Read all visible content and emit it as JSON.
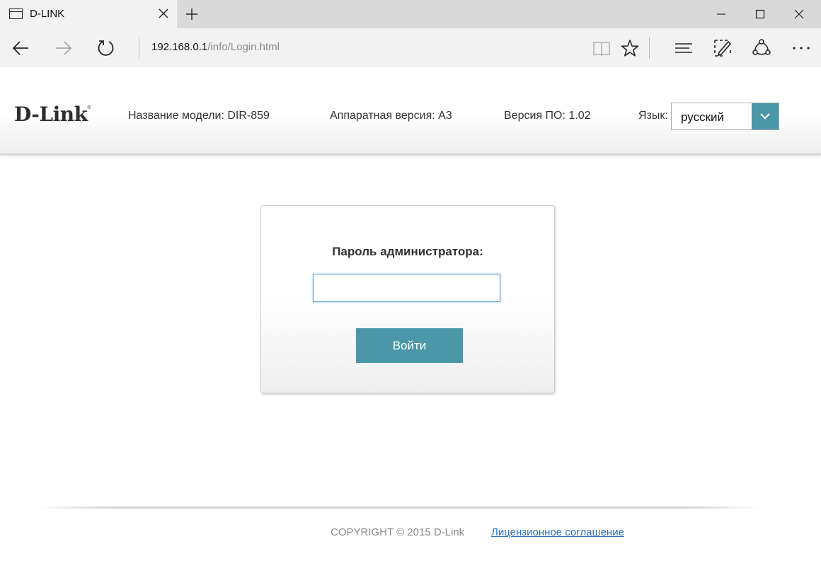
{
  "browser": {
    "tab_title": "D-LINK",
    "address": {
      "host": "192.168.0.1",
      "path": "/info/Login.html"
    }
  },
  "header": {
    "logo": "D-Link",
    "model": "Название модели: DIR-859",
    "hardware": "Аппаратная версия: A3",
    "firmware": "Версия ПО: 1.02",
    "language_label": "Язык:",
    "language_value": "русский"
  },
  "login": {
    "label": "Пароль администратора:",
    "password_value": "",
    "button_label": "Войти"
  },
  "footer": {
    "copyright": "COPYRIGHT © 2015 D-Link",
    "license_link": "Лицензионное соглашение"
  },
  "colors": {
    "accent": "#4a97a7",
    "link": "#2a6fbf"
  }
}
